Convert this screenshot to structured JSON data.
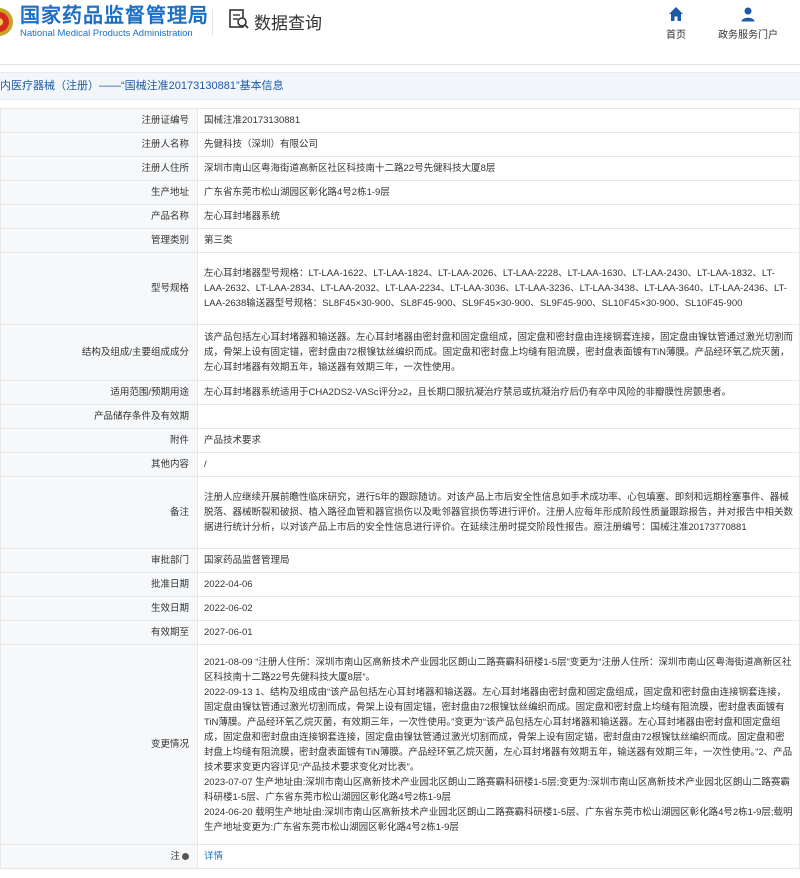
{
  "header": {
    "logo_cn": "国家药品监督管理局",
    "logo_en": "National Medical Products Administration",
    "section_title": "数据查询",
    "nav": [
      {
        "label": "首页",
        "icon": "home-icon"
      },
      {
        "label": "政务服务门户",
        "icon": "user-icon"
      }
    ]
  },
  "breadcrumb": "内医疗器械（注册）——“国械注准20173130881”基本信息",
  "rows": [
    {
      "key": "注册证编号",
      "value": "国械注准20173130881"
    },
    {
      "key": "注册人名称",
      "value": "先健科技（深圳）有限公司"
    },
    {
      "key": "注册人住所",
      "value": "深圳市南山区粤海街道高新区社区科技南十二路22号先健科技大厦8层"
    },
    {
      "key": "生产地址",
      "value": "广东省东莞市松山湖园区彰化路4号2栋1-9层"
    },
    {
      "key": "产品名称",
      "value": "左心耳封堵器系统"
    },
    {
      "key": "管理类别",
      "value": "第三类"
    },
    {
      "key": "型号规格",
      "value": "左心耳封堵器型号规格：LT-LAA-1622、LT-LAA-1824、LT-LAA-2026、LT-LAA-2228、LT-LAA-1630、LT-LAA-2430、LT-LAA-1832、LT-LAA-2632、LT-LAA-2834、LT-LAA-2032、LT-LAA-2234、LT-LAA-3036、LT-LAA-3236、LT-LAA-3438、LT-LAA-3640、LT-LAA-2436、LT-LAA-2638输送器型号规格：SL8F45×30-900、SL8F45-900、SL9F45×30-900、SL9F45-900、SL10F45×30-900、SL10F45-900"
    },
    {
      "key": "结构及组成/主要组成成分",
      "value": "该产品包括左心耳封堵器和输送器。左心耳封堵器由密封盘和固定盘组成，固定盘和密封盘由连接钢套连接，固定盘由镍钛管通过激光切割而成，骨架上设有固定锚，密封盘由72根镍钛丝编织而成。固定盘和密封盘上均缝有阻流膜，密封盘表面镀有TiN薄膜。产品经环氧乙烷灭菌，左心耳封堵器有效期五年，输送器有效期三年，一次性使用。"
    },
    {
      "key": "适用范围/预期用途",
      "value": "左心耳封堵器系统适用于CHA2DS2-VASc评分≥2，且长期口服抗凝治疗禁忌或抗凝治疗后仍有卒中风险的非瓣膜性房颤患者。"
    },
    {
      "key": "产品储存条件及有效期",
      "value": ""
    },
    {
      "key": "附件",
      "value": "产品技术要求"
    },
    {
      "key": "其他内容",
      "value": "/"
    },
    {
      "key": "备注",
      "value": "注册人应继续开展前瞻性临床研究，进行5年的跟踪随访。对该产品上市后安全性信息如手术成功率、心包填塞、即刻和远期栓塞事件、器械脱落、器械断裂和破损、植入路径血管和器官损伤以及毗邻器官损伤等进行评价。注册人应每年形成阶段性质量跟踪报告，并对报告中相关数据进行统计分析，以对该产品上市后的安全性信息进行评价。在延续注册时提交阶段性报告。原注册编号：国械注准20173770881"
    },
    {
      "key": "审批部门",
      "value": "国家药品监督管理局"
    },
    {
      "key": "批准日期",
      "value": "2022-04-06"
    },
    {
      "key": "生效日期",
      "value": "2022-06-02"
    },
    {
      "key": "有效期至",
      "value": "2027-06-01"
    },
    {
      "key": "变更情况",
      "value": "2021-08-09 “注册人住所：深圳市南山区高新技术产业园北区朗山二路赛霸科研楼1-5层”变更为“注册人住所：深圳市南山区粤海街道高新区社区科技南十二路22号先健科技大厦8层”。\n2022-09-13 1、结构及组成由“该产品包括左心耳封堵器和输送器。左心耳封堵器由密封盘和固定盘组成，固定盘和密封盘由连接钢套连接，固定盘由镍钛管通过激光切割而成，骨架上设有固定锚，密封盘由72根镍钛丝编织而成。固定盘和密封盘上均缝有阻流膜，密封盘表面镀有TiN薄膜。产品经环氧乙烷灭菌，有效期三年，一次性使用。”变更为“该产品包括左心耳封堵器和输送器。左心耳封堵器由密封盘和固定盘组成，固定盘和密封盘由连接钢套连接，固定盘由镍钛管通过激光切割而成，骨架上设有固定锚，密封盘由72根镍钛丝编织而成。固定盘和密封盘上均缝有阻流膜，密封盘表面镀有TiN薄膜。产品经环氧乙烷灭菌，左心耳封堵器有效期五年，输送器有效期三年，一次性使用。”2、产品技术要求变更内容详见“产品技术要求变化对比表”。\n2023-07-07 生产地址由:深圳市南山区高新技术产业园北区朗山二路赛霸科研楼1-5层;变更为:深圳市南山区高新技术产业园北区朗山二路赛霸科研楼1-5层、广东省东莞市松山湖园区彰化路4号2栋1-9层\n2024-06-20 载明生产地址由:深圳市南山区高新技术产业园北区朗山二路赛霸科研楼1-5层、广东省东莞市松山湖园区彰化路4号2栋1-9层;载明生产地址变更为:广东省东莞市松山湖园区彰化路4号2栋1-9层"
    },
    {
      "key": "注",
      "value": "详情"
    }
  ],
  "colors": {
    "brand": "#1d6fc5",
    "key_bg": "#f7f8fa",
    "border": "#e8e8e8"
  }
}
